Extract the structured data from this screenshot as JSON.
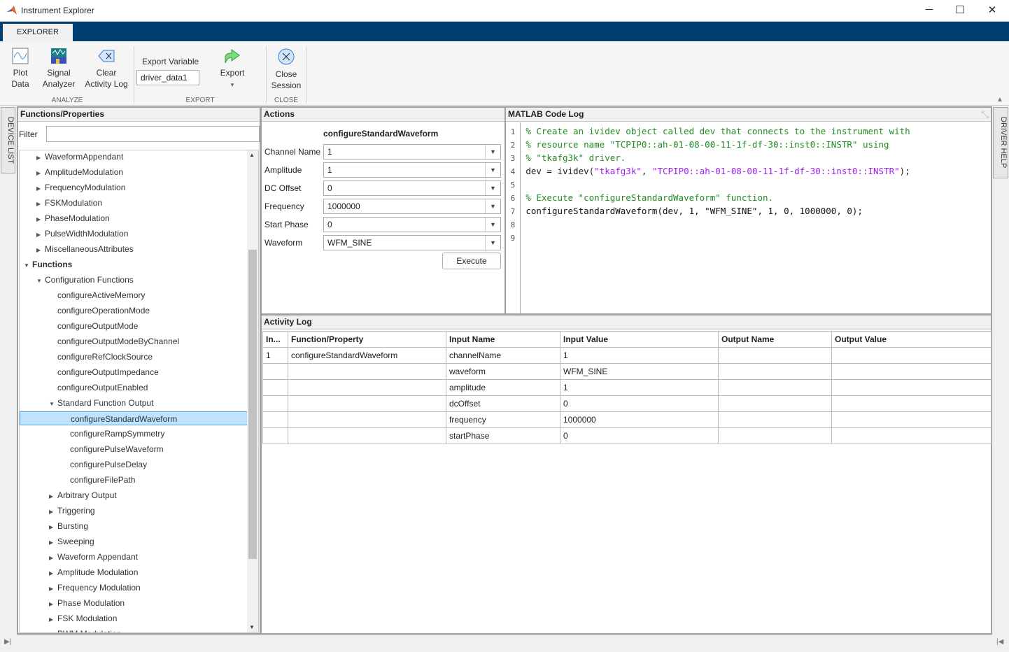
{
  "window": {
    "title": "Instrument Explorer",
    "minimize": "─",
    "maximize": "☐",
    "close": "✕"
  },
  "ribbon": {
    "tab": "EXPLORER",
    "analyze": {
      "group": "ANALYZE",
      "plot_data": [
        "Plot",
        "Data"
      ],
      "signal_analyzer": [
        "Signal",
        "Analyzer"
      ],
      "clear_log": [
        "Clear",
        "Activity Log"
      ]
    },
    "export": {
      "group": "EXPORT",
      "label": "Export Variable",
      "value": "driver_data1",
      "button": "Export"
    },
    "close": {
      "group": "CLOSE",
      "button": [
        "Close",
        "Session"
      ]
    }
  },
  "side_tabs": {
    "left": "DEVICE LIST",
    "right": "DRIVER HELP"
  },
  "functions_panel": {
    "title": "Functions/Properties",
    "filter_label": "Filter",
    "filter_value": "",
    "tree": [
      {
        "label": "WaveformAppendant",
        "level": 1,
        "state": "collapsed"
      },
      {
        "label": "AmplitudeModulation",
        "level": 1,
        "state": "collapsed"
      },
      {
        "label": "FrequencyModulation",
        "level": 1,
        "state": "collapsed"
      },
      {
        "label": "FSKModulation",
        "level": 1,
        "state": "collapsed"
      },
      {
        "label": "PhaseModulation",
        "level": 1,
        "state": "collapsed"
      },
      {
        "label": "PulseWidthModulation",
        "level": 1,
        "state": "collapsed"
      },
      {
        "label": "MiscellaneousAttributes",
        "level": 1,
        "state": "collapsed"
      },
      {
        "label": "Functions",
        "level": 0,
        "state": "expanded",
        "bold": true
      },
      {
        "label": "Configuration Functions",
        "level": 1,
        "state": "expanded"
      },
      {
        "label": "configureActiveMemory",
        "level": 2,
        "state": "leaf"
      },
      {
        "label": "configureOperationMode",
        "level": 2,
        "state": "leaf"
      },
      {
        "label": "configureOutputMode",
        "level": 2,
        "state": "leaf"
      },
      {
        "label": "configureOutputModeByChannel",
        "level": 2,
        "state": "leaf"
      },
      {
        "label": "configureRefClockSource",
        "level": 2,
        "state": "leaf"
      },
      {
        "label": "configureOutputImpedance",
        "level": 2,
        "state": "leaf"
      },
      {
        "label": "configureOutputEnabled",
        "level": 2,
        "state": "leaf"
      },
      {
        "label": "Standard Function Output",
        "level": 2,
        "state": "expanded"
      },
      {
        "label": "configureStandardWaveform",
        "level": 3,
        "state": "leaf",
        "selected": true
      },
      {
        "label": "configureRampSymmetry",
        "level": 3,
        "state": "leaf"
      },
      {
        "label": "configurePulseWaveform",
        "level": 3,
        "state": "leaf"
      },
      {
        "label": "configurePulseDelay",
        "level": 3,
        "state": "leaf"
      },
      {
        "label": "configureFilePath",
        "level": 3,
        "state": "leaf"
      },
      {
        "label": "Arbitrary Output",
        "level": 2,
        "state": "collapsed"
      },
      {
        "label": "Triggering",
        "level": 2,
        "state": "collapsed"
      },
      {
        "label": "Bursting",
        "level": 2,
        "state": "collapsed"
      },
      {
        "label": "Sweeping",
        "level": 2,
        "state": "collapsed"
      },
      {
        "label": "Waveform Appendant",
        "level": 2,
        "state": "collapsed"
      },
      {
        "label": "Amplitude Modulation",
        "level": 2,
        "state": "collapsed"
      },
      {
        "label": "Frequency Modulation",
        "level": 2,
        "state": "collapsed"
      },
      {
        "label": "Phase Modulation",
        "level": 2,
        "state": "collapsed"
      },
      {
        "label": "FSK Modulation",
        "level": 2,
        "state": "collapsed"
      },
      {
        "label": "PWM Modulation",
        "level": 2,
        "state": "collapsed"
      }
    ]
  },
  "actions": {
    "title": "Actions",
    "function": "configureStandardWaveform",
    "params": [
      {
        "label": "Channel Name",
        "value": "1"
      },
      {
        "label": "Amplitude",
        "value": "1"
      },
      {
        "label": "DC Offset",
        "value": "0"
      },
      {
        "label": "Frequency",
        "value": "1000000"
      },
      {
        "label": "Start Phase",
        "value": "0"
      },
      {
        "label": "Waveform",
        "value": "WFM_SINE"
      }
    ],
    "execute": "Execute"
  },
  "code_log": {
    "title": "MATLAB Code Log",
    "lines": [
      "% Create an ividev object called dev that connects to the instrument with",
      "% resource name \"TCPIP0::ah-01-08-00-11-1f-df-30::inst0::INSTR\" using",
      "% \"tkafg3k\" driver.",
      "dev = ividev(\"tkafg3k\", \"TCPIP0::ah-01-08-00-11-1f-df-30::inst0::INSTR\");",
      "",
      "% Execute \"configureStandardWaveform\" function.",
      "configureStandardWaveform(dev, 1, \"WFM_SINE\", 1, 0, 1000000, 0);",
      "",
      ""
    ]
  },
  "activity_log": {
    "title": "Activity Log",
    "columns": [
      "In...",
      "Function/Property",
      "Input Name",
      "Input Value",
      "Output Name",
      "Output Value"
    ],
    "rows": [
      [
        "1",
        "configureStandardWaveform",
        "channelName",
        "1",
        "",
        ""
      ],
      [
        "",
        "",
        "waveform",
        "WFM_SINE",
        "",
        ""
      ],
      [
        "",
        "",
        "amplitude",
        "1",
        "",
        ""
      ],
      [
        "",
        "",
        "dcOffset",
        "0",
        "",
        ""
      ],
      [
        "",
        "",
        "frequency",
        "1000000",
        "",
        ""
      ],
      [
        "",
        "",
        "startPhase",
        "0",
        "",
        ""
      ]
    ]
  },
  "colors": {
    "ribbon_blue": "#003f72",
    "selection": "#bfe3ff",
    "comment": "#228b22",
    "string": "#a020f0"
  }
}
